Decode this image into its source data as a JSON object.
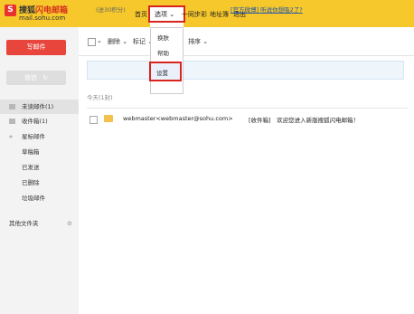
{
  "logo": {
    "mark": "S",
    "title_prefix": "搜狐",
    "title_suffix": "闪电邮箱",
    "domain": "mail.sohu.com"
  },
  "nav": {
    "home": "首页",
    "options": "选项",
    "sync": "一同步彩",
    "addressbook": "地址簿",
    "logout": "退出"
  },
  "sidebar": {
    "write": "写邮件",
    "receive": "收信",
    "items": [
      {
        "label": "未读邮件(1)",
        "icon": "unread-icon"
      },
      {
        "label": "收件箱(1)",
        "icon": "inbox-icon"
      },
      {
        "label": "星标邮件",
        "icon": "star-icon"
      },
      {
        "label": "草稿箱"
      },
      {
        "label": "已发送"
      },
      {
        "label": "已删除"
      },
      {
        "label": "垃圾邮件"
      },
      {
        "label": "其他文件夹"
      }
    ]
  },
  "toolbar": {
    "delete": "删除",
    "mark": "标记",
    "sort": "排序"
  },
  "dropdown": {
    "items": [
      "换肤",
      "帮助",
      "设置"
    ]
  },
  "notice": {
    "left": "(送30积分)",
    "right": "[官方微博] 听说你想吸2了?"
  },
  "list": {
    "group_label": "今天(1封)",
    "rows": [
      {
        "sender": "webmaster<webmaster@sohu.com>",
        "subject": "[收件箱]　欢迎您进入新版搜狐闪电邮箱！"
      }
    ]
  },
  "colors": {
    "topbar": "#f6c82b",
    "accent": "#e8453c",
    "highlight": "#d8261f"
  }
}
